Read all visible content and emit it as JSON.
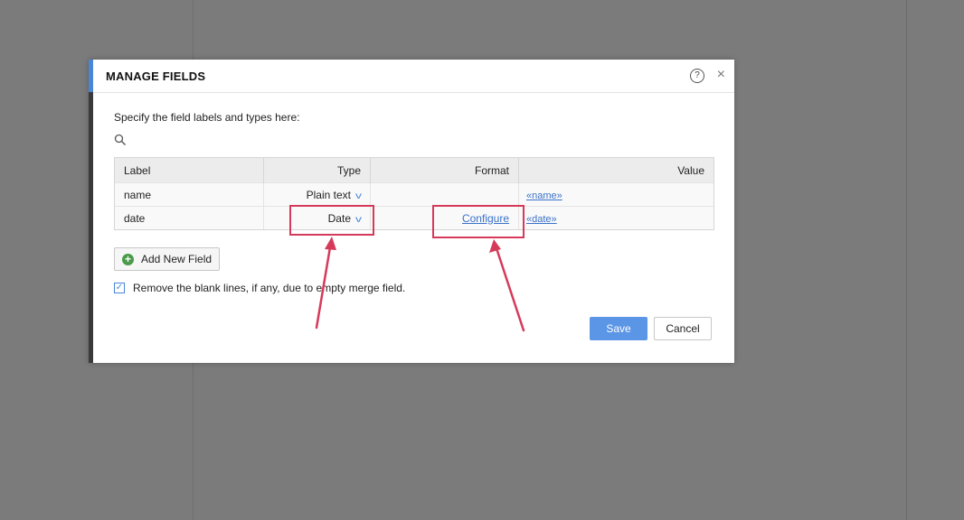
{
  "dialog": {
    "title": "MANAGE FIELDS",
    "help_icon": "?",
    "close_icon": "×",
    "instructions": "Specify the field labels and types here:",
    "search_icon": "search-icon"
  },
  "table": {
    "headers": [
      "Label",
      "Type",
      "Format",
      "Value"
    ],
    "rows": [
      {
        "label": "name",
        "type": "Plain text",
        "format": "",
        "value": "«name»"
      },
      {
        "label": "date",
        "type": "Date",
        "format": "Configure",
        "value": "«date»"
      }
    ]
  },
  "add_field": {
    "label": "Add New Field",
    "icon": "plus-circle-icon"
  },
  "remove_blank": {
    "label": "Remove the blank lines, if any, due to empty merge field.",
    "checked": true
  },
  "buttons": {
    "save": "Save",
    "cancel": "Cancel"
  },
  "colors": {
    "accent": "#4a86d8",
    "highlight": "#d63a5a",
    "save": "#5b95e6"
  }
}
